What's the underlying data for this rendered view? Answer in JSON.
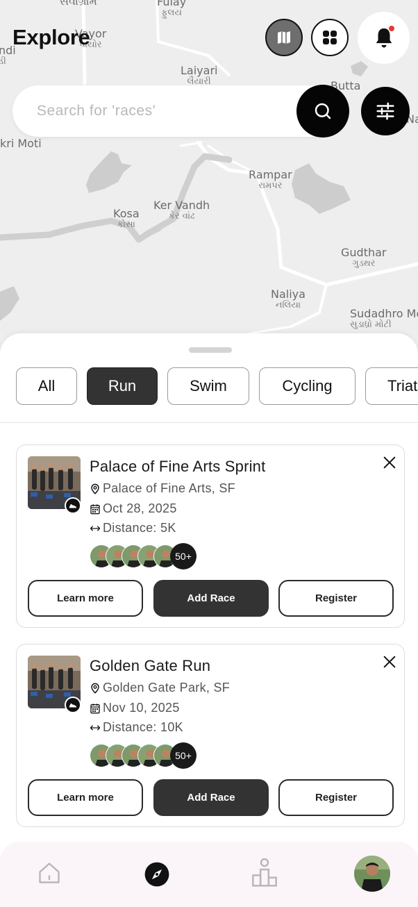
{
  "map": {
    "labels": [
      {
        "name": "Sevagram",
        "primary": "સેવાગ્રામ",
        "secondary": ""
      },
      {
        "name": "Fulay",
        "primary": "Fulay",
        "secondary": "ફુલય"
      },
      {
        "name": "Vayor",
        "primary": "Vayor",
        "secondary": "વાયોર"
      },
      {
        "name": "Mandi",
        "primary": "ndi",
        "secondary": "ડી"
      },
      {
        "name": "Laiyari",
        "primary": "Laiyari",
        "secondary": "લૈયારી"
      },
      {
        "name": "Butta",
        "primary": "Butta",
        "secondary": ""
      },
      {
        "name": "Na",
        "primary": "Na",
        "secondary": ""
      },
      {
        "name": "Vakri Moti",
        "primary": "kri Moti",
        "secondary": ""
      },
      {
        "name": "Rampar",
        "primary": "Rampar",
        "secondary": "રામપર"
      },
      {
        "name": "Kosa",
        "primary": "Kosa",
        "secondary": "કોસા"
      },
      {
        "name": "Ker Vandh",
        "primary": "Ker Vandh",
        "secondary": "કેર વાંઢ"
      },
      {
        "name": "Gudthar",
        "primary": "Gudthar",
        "secondary": "ગુડથર"
      },
      {
        "name": "Naliya",
        "primary": "Naliya",
        "secondary": "નલિયા"
      },
      {
        "name": "Sudadhro Moti",
        "primary": "Sudadhro Mo",
        "secondary": "સુડાધ્રો મોટી"
      }
    ]
  },
  "header": {
    "title": "Explore",
    "icons": {
      "map_view": "map-icon",
      "grid_view": "grid-icon",
      "notifications": "bell-icon"
    },
    "notification_dot_color": "#e53935"
  },
  "search": {
    "placeholder": "Search for 'races'",
    "value": "",
    "search_icon": "search-icon",
    "filter_icon": "sliders-icon"
  },
  "filters": {
    "chips": [
      {
        "label": "All",
        "active": false
      },
      {
        "label": "Run",
        "active": true
      },
      {
        "label": "Swim",
        "active": false
      },
      {
        "label": "Cycling",
        "active": false
      },
      {
        "label": "Triath",
        "active": false
      }
    ]
  },
  "races": [
    {
      "title": "Palace of Fine Arts Sprint",
      "location": "Palace of Fine Arts, SF",
      "date": "Oct 28, 2025",
      "distance": "Distance: 5K",
      "participants_more": "50+",
      "learn_more": "Learn more",
      "add_race": "Add Race",
      "register": "Register",
      "sport_icon": "running-shoe-icon"
    },
    {
      "title": "Golden Gate Run",
      "location": "Golden Gate Park, SF",
      "date": "Nov 10, 2025",
      "distance": "Distance: 10K",
      "participants_more": "50+",
      "learn_more": "Learn more",
      "add_race": "Add Race",
      "register": "Register",
      "sport_icon": "running-shoe-icon"
    }
  ],
  "bottom_nav": {
    "items": [
      "home-icon",
      "compass-icon",
      "leaderboard-icon",
      "profile-avatar"
    ],
    "active": "compass-icon"
  },
  "colors": {
    "accent_dark": "#333333",
    "map_bg": "#eeeeee",
    "nav_bg": "#fbf5fa"
  }
}
